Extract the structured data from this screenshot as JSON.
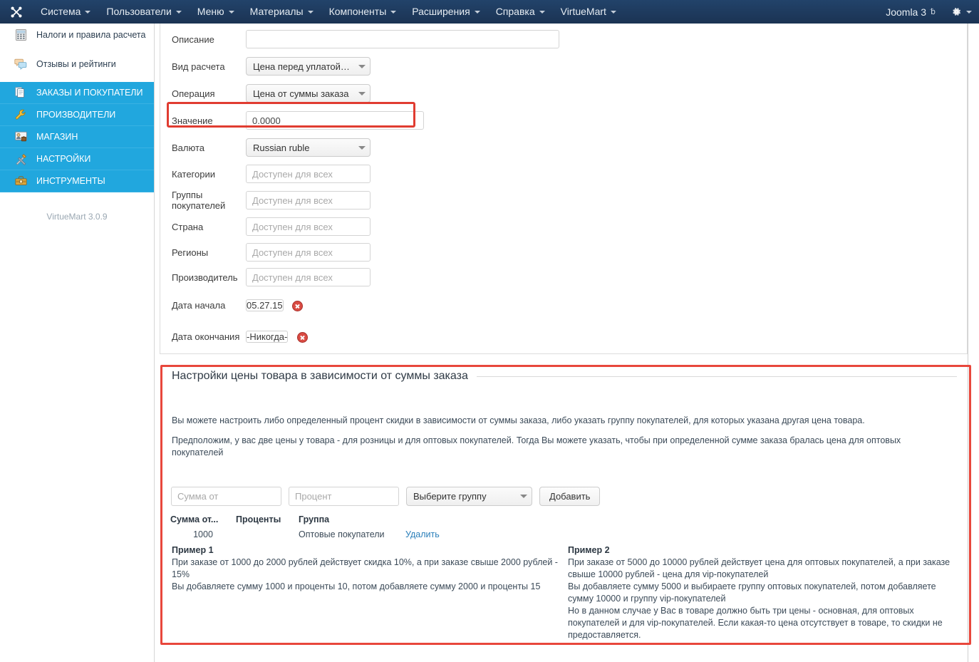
{
  "topnav": {
    "logo_icon": "joomla-logo-icon",
    "items": [
      {
        "label": "Система",
        "caret": true
      },
      {
        "label": "Пользователи",
        "caret": true
      },
      {
        "label": "Меню",
        "caret": true
      },
      {
        "label": "Материалы",
        "caret": true
      },
      {
        "label": "Компоненты",
        "caret": true
      },
      {
        "label": "Расширения",
        "caret": true
      },
      {
        "label": "Справка",
        "caret": true
      },
      {
        "label": "VirtueMart",
        "caret": true
      }
    ],
    "site_label": "Joomla 3",
    "external_icon": "external-link-icon",
    "gear_icon": "gear-icon"
  },
  "sidebar": {
    "items": [
      {
        "label": "Налоги и правила расчета",
        "icon": "calculator-icon",
        "active": false
      },
      {
        "label": "Отзывы и рейтинги",
        "icon": "comments-icon",
        "active": false
      },
      {
        "label": "ЗАКАЗЫ И ПОКУПАТЕЛИ",
        "icon": "orders-icon",
        "active": true
      },
      {
        "label": "ПРОИЗВОДИТЕЛИ",
        "icon": "wrench-icon",
        "active": true
      },
      {
        "label": "МАГАЗИН",
        "icon": "shop-icon",
        "active": true
      },
      {
        "label": "НАСТРОЙКИ",
        "icon": "tools-icon",
        "active": true
      },
      {
        "label": "ИНСТРУМЕНТЫ",
        "icon": "toolbox-icon",
        "active": true
      }
    ],
    "version": "VirtueMart 3.0.9"
  },
  "form": {
    "rows": [
      {
        "label": "Описание",
        "type": "text",
        "value": "",
        "placeholder": ""
      },
      {
        "label": "Вид расчета",
        "type": "select",
        "value": "Цена перед уплатой…"
      },
      {
        "label": "Операция",
        "type": "select",
        "value": "Цена от суммы заказа"
      },
      {
        "label": "Значение",
        "type": "text",
        "value": "0.0000",
        "placeholder": ""
      },
      {
        "label": "Валюта",
        "type": "select",
        "value": "Russian ruble"
      },
      {
        "label": "Категории",
        "type": "text",
        "value": "",
        "placeholder": "Доступен для всех"
      },
      {
        "label": "Группы покупателей",
        "type": "text",
        "value": "",
        "placeholder": "Доступен для всех"
      },
      {
        "label": "Страна",
        "type": "text",
        "value": "",
        "placeholder": "Доступен для всех"
      },
      {
        "label": "Регионы",
        "type": "text",
        "value": "",
        "placeholder": "Доступен для всех"
      },
      {
        "label": "Производитель",
        "type": "text",
        "value": "",
        "placeholder": "Доступен для всех"
      },
      {
        "label": "Дата начала",
        "type": "date",
        "value": "05.27.15"
      },
      {
        "label": "Дата окончания",
        "type": "date",
        "value": "-Никогда-"
      }
    ],
    "labels": {
      "description": "Описание",
      "calc_type": "Вид расчета",
      "operation": "Операция",
      "value": "Значение",
      "currency": "Валюта",
      "categories": "Категории",
      "shopper_groups_line1": "Группы",
      "shopper_groups_line2": "покупателей",
      "country": "Страна",
      "regions": "Регионы",
      "manufacturer": "Производитель",
      "date_start": "Дата начала",
      "date_end": "Дата окончания"
    },
    "values": {
      "description": "",
      "calc_type": "Цена перед уплатой…",
      "operation": "Цена от суммы заказа",
      "value": "0.0000",
      "currency": "Russian ruble",
      "date_start": "05.27.15",
      "date_end": "-Никогда-"
    },
    "placeholders": {
      "available_all": "Доступен для всех"
    }
  },
  "fieldset": {
    "legend": "Настройки цены товара в зависимости от суммы заказа",
    "para1": "Вы можете настроить либо определенный процент скидки в зависимости от суммы заказа, либо указать группу покупателей, для которых указана другая цена товара.",
    "para2": "Предположим, у вас две цены у товара - для розницы и для оптовых покупателей. Тогда Вы можете указать, чтобы при определенной сумме заказа бралась цена для оптовых покупателей",
    "inputs": {
      "sum_placeholder": "Сумма от",
      "sum_value": "",
      "percent_placeholder": "Процент",
      "percent_value": "",
      "group_select": "Выберите группу",
      "add_button": "Добавить"
    },
    "table": {
      "headers": [
        "Сумма от...",
        "Проценты",
        "Группа",
        ""
      ],
      "rows": [
        {
          "sum": "1000",
          "percent": "",
          "group": "Оптовые покупатели",
          "action": "Удалить"
        }
      ]
    },
    "example1": {
      "title": "Пример 1",
      "lines": [
        "При заказе от 1000 до 2000 рублей действует скидка 10%, а при заказе свыше 2000 рублей - 15%",
        "Вы добавляете сумму 1000 и проценты 10, потом добавляете сумму 2000 и проценты 15"
      ]
    },
    "example2": {
      "title": "Пример 2",
      "lines": [
        "При заказе от 5000 до 10000 рублей действует цена для оптовых покупателей, а при заказе свыше 10000 рублей - цена для vip-покупателей",
        "Вы добавляете сумму 5000 и выбираете группу оптовых покупателей, потом добавляете сумму 10000 и группу vip-покупателей",
        "Но в данном случае у Вас в товаре должно быть три цены - основная, для оптовых покупателей и для vip-покупателей. Если какая-то цена отсутствует в товаре, то скидки не предоставляется."
      ]
    }
  },
  "colors": {
    "navbar": "#1b3353",
    "sidebar_active": "#21a7de",
    "highlight_red": "#e03c31",
    "link_blue": "#2a7fba"
  }
}
